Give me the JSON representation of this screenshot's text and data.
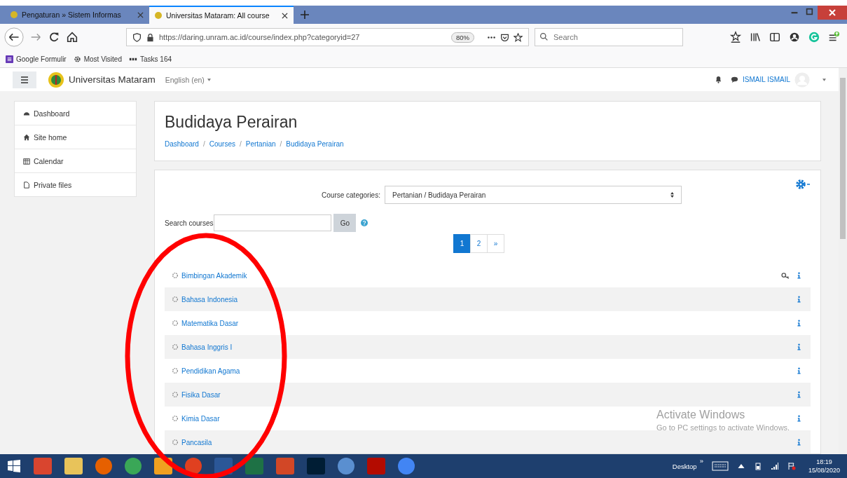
{
  "browser": {
    "tabs": [
      {
        "title": "Pengaturan » Sistem Informas",
        "selected": false
      },
      {
        "title": "Universitas Mataram: All course",
        "selected": true
      }
    ],
    "url": "https://daring.unram.ac.id/course/index.php?categoryid=27",
    "zoom": "80%",
    "search": {
      "placeholder": "Search"
    },
    "bookmarks": [
      {
        "label": "Google Formulir",
        "kind": "form"
      },
      {
        "label": "Most Visited",
        "kind": "gear"
      },
      {
        "label": "Tasks  164",
        "kind": "pkp"
      }
    ]
  },
  "header": {
    "site_name": "Universitas Mataram",
    "language": "English (en)",
    "user_name": "ISMAIL ISMAIL"
  },
  "sidebar": {
    "items": [
      {
        "label": "Dashboard",
        "kind": "dashboard"
      },
      {
        "label": "Site home",
        "kind": "home"
      },
      {
        "label": "Calendar",
        "kind": "calendar"
      },
      {
        "label": "Private files",
        "kind": "file"
      }
    ]
  },
  "page": {
    "title": "Budidaya Perairan",
    "breadcrumb": [
      "Dashboard",
      "Courses",
      "Pertanian",
      "Budidaya Perairan"
    ],
    "breadcrumb_separator": "/"
  },
  "categories": {
    "label": "Course categories:",
    "value": "Pertanian / Budidaya Perairan"
  },
  "search_courses": {
    "label": "Search courses",
    "button": "Go"
  },
  "pager": [
    {
      "label": "1",
      "selected": true
    },
    {
      "label": "2",
      "selected": false
    },
    {
      "label": "»",
      "selected": false
    }
  ],
  "courses": [
    {
      "name": "Bimbingan Akademik",
      "enrolment_key": true
    },
    {
      "name": "Bahasa Indonesia",
      "enrolment_key": false
    },
    {
      "name": "Matematika Dasar",
      "enrolment_key": false
    },
    {
      "name": "Bahasa Inggris I",
      "enrolment_key": false
    },
    {
      "name": "Pendidikan Agama",
      "enrolment_key": false
    },
    {
      "name": "Fisika Dasar",
      "enrolment_key": false
    },
    {
      "name": "Kimia Dasar",
      "enrolment_key": false
    },
    {
      "name": "Pancasila",
      "enrolment_key": false
    }
  ],
  "activation_notice": {
    "title": "Activate Windows",
    "text": "Go to PC settings to activate Windows."
  },
  "taskbar": {
    "apps": [
      {
        "kind": "book",
        "color": "#d9452f"
      },
      {
        "kind": "folder",
        "color": "#e8c35a"
      },
      {
        "kind": "firefox",
        "color": "#e66000"
      },
      {
        "kind": "chrome",
        "color": "#3aa757"
      },
      {
        "kind": "media",
        "color": "#f0a020"
      },
      {
        "kind": "recorder",
        "color": "#e04020"
      },
      {
        "kind": "word",
        "color": "#2b5797"
      },
      {
        "kind": "excel",
        "color": "#1e7145"
      },
      {
        "kind": "powerpoint",
        "color": "#d24726"
      },
      {
        "kind": "photoshop",
        "color": "#001d34"
      },
      {
        "kind": "math",
        "color": "#5a8fd0"
      },
      {
        "kind": "pdf",
        "color": "#b30b00"
      },
      {
        "kind": "chrome",
        "color": "#4285f4"
      }
    ],
    "desktop": "Desktop",
    "chevron": "»",
    "time": "18:19",
    "date": "15/08/2020"
  }
}
